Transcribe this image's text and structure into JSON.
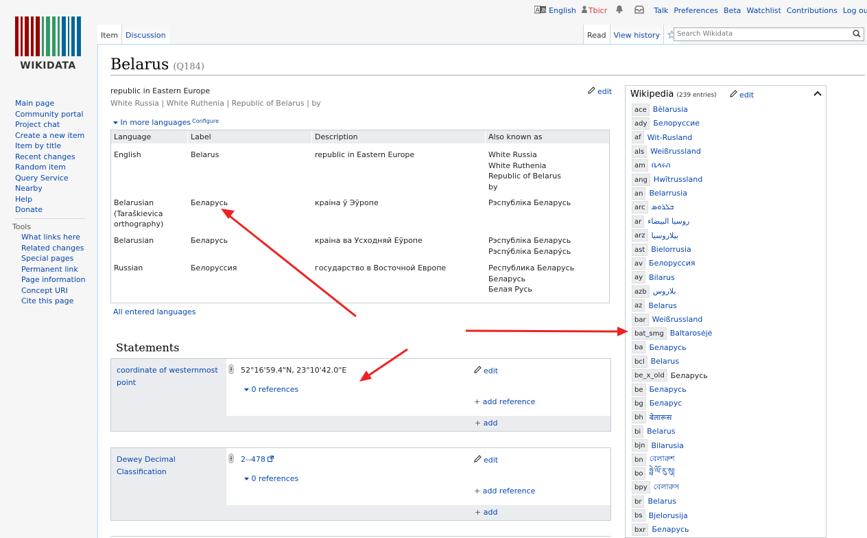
{
  "personal": {
    "language": "English",
    "user": "Tbicr",
    "links": [
      "Talk",
      "Preferences",
      "Beta",
      "Watchlist",
      "Contributions",
      "Log out"
    ]
  },
  "logo": {
    "wordmark": "WIKIDATA"
  },
  "sidebar": {
    "nav": [
      "Main page",
      "Community portal",
      "Project chat",
      "Create a new item",
      "Item by title",
      "Recent changes",
      "Random item",
      "Query Service",
      "Nearby",
      "Help",
      "Donate"
    ],
    "tools_heading": "Tools",
    "tools": [
      "What links here",
      "Related changes",
      "Special pages",
      "Permanent link",
      "Page information",
      "Concept URI",
      "Cite this page"
    ]
  },
  "tabs": {
    "left": [
      "Item",
      "Discussion"
    ],
    "right": [
      "Read",
      "View history"
    ]
  },
  "search": {
    "placeholder": "Search Wikidata"
  },
  "item": {
    "label": "Belarus",
    "qid": "(Q184)",
    "description": "republic in Eastern Europe",
    "aliases": "White Russia | White Ruthenia | Republic of Belarus | by",
    "edit": "edit"
  },
  "languages": {
    "toggle": "In more languages",
    "configure": "Configure",
    "headers": [
      "Language",
      "Label",
      "Description",
      "Also known as"
    ],
    "rows": [
      {
        "language": [
          "English"
        ],
        "label": "Belarus",
        "description": "republic in Eastern Europe",
        "aliases": [
          "White Russia",
          "White Ruthenia",
          "Republic of Belarus",
          "by"
        ]
      },
      {
        "language": [
          "Belarusian",
          "(Taraškievica",
          "orthography)"
        ],
        "label": "Беларусь",
        "description": "краіна ў Эўропе",
        "aliases": [
          "Рэспубліка Беларусь"
        ]
      },
      {
        "language": [
          "Belarusian"
        ],
        "label": "Беларусь",
        "description": "краіна ва Усходняй Еўропе",
        "aliases": [
          "Рэспубліка Беларусь",
          "Рэспу́бліка Белару́сь"
        ]
      },
      {
        "language": [
          "Russian"
        ],
        "label": "Белоруссия",
        "description": "государство в Восточной Европе",
        "aliases": [
          "Республика Беларусь",
          "Беларусь",
          "Белая Русь"
        ]
      }
    ],
    "all_entered": "All entered languages"
  },
  "statements": {
    "heading": "Statements",
    "items": [
      {
        "property": [
          "coordinate of westernmost",
          "point"
        ],
        "value": "52°16'59.4\"N, 23°10'42.0\"E",
        "references": "0 references",
        "edit": "edit",
        "add_reference": "add reference",
        "add": "add"
      },
      {
        "property": [
          "Dewey Decimal",
          "Classification"
        ],
        "value": "2--478",
        "references": "0 references",
        "edit": "edit",
        "add_reference": "add reference",
        "add": "add"
      }
    ]
  },
  "wikipedia": {
    "title": "Wikipedia",
    "count": "(239 entries)",
    "edit": "edit",
    "links": [
      {
        "code": "ace",
        "title": "Bèlarusia"
      },
      {
        "code": "ady",
        "title": "Белоруссие"
      },
      {
        "code": "af",
        "title": "Wit-Rusland"
      },
      {
        "code": "als",
        "title": "Weißrussland"
      },
      {
        "code": "am",
        "title": "ቤላሩስ"
      },
      {
        "code": "ang",
        "title": "Hwītrussland"
      },
      {
        "code": "an",
        "title": "Belarrusia"
      },
      {
        "code": "arc",
        "title": "ܒܠܪܘܣ"
      },
      {
        "code": "ar",
        "title": "روسيا البيضاء"
      },
      {
        "code": "arz",
        "title": "بيلاروسيا"
      },
      {
        "code": "ast",
        "title": "Bielorrusia"
      },
      {
        "code": "av",
        "title": "Белоруссия"
      },
      {
        "code": "ay",
        "title": "Bilarus"
      },
      {
        "code": "azb",
        "title": "بلاروس"
      },
      {
        "code": "az",
        "title": "Belarus"
      },
      {
        "code": "bar",
        "title": "Weißrussland"
      },
      {
        "code": "bat_smg",
        "title": "Baltarosėjė"
      },
      {
        "code": "ba",
        "title": "Беларусь"
      },
      {
        "code": "bcl",
        "title": "Belarus"
      },
      {
        "code": "be_x_old",
        "title": "Беларусь"
      },
      {
        "code": "be",
        "title": "Беларусь"
      },
      {
        "code": "bg",
        "title": "Беларус"
      },
      {
        "code": "bh",
        "title": "बेलारूस"
      },
      {
        "code": "bi",
        "title": "Belarus"
      },
      {
        "code": "bjn",
        "title": "Bilarusia"
      },
      {
        "code": "bn",
        "title": "বেলারুশ"
      },
      {
        "code": "bo",
        "title": "ཧྥེ་ལོ་རུ་སུ།"
      },
      {
        "code": "bpy",
        "title": "বেলারুস"
      },
      {
        "code": "br",
        "title": "Belarus"
      },
      {
        "code": "bs",
        "title": "Bjelorusija"
      },
      {
        "code": "bxr",
        "title": "Беларусь"
      }
    ]
  },
  "colors": {
    "link": "#0645ad",
    "arrow": "#ee2222",
    "logo_red": "#990000",
    "logo_green": "#339966",
    "logo_blue": "#006699"
  }
}
